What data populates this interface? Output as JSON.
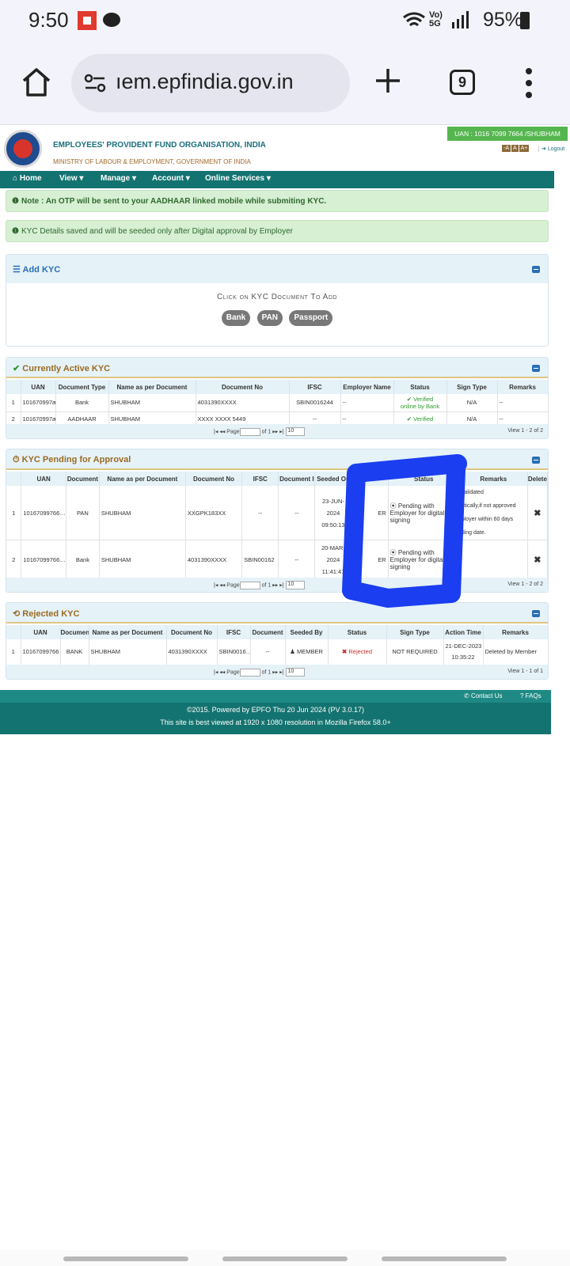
{
  "status_bar": {
    "time": "9:50",
    "signal_label": "Vo) 5G",
    "battery": "95%"
  },
  "browser": {
    "url": "ıem.epfindia.gov.in",
    "tab_count": "9"
  },
  "header": {
    "org_name": "EMPLOYEES' PROVIDENT FUND ORGANISATION, INDIA",
    "ministry": "MINISTRY OF LABOUR & EMPLOYMENT, GOVERNMENT OF INDIA",
    "uan_badge": "UAN : 1016 7099 7664 /SHUBHAM",
    "font_sizes": [
      "-A",
      "A",
      "A+"
    ],
    "logout": "Logout"
  },
  "nav": {
    "home": "Home",
    "view": "View ▾",
    "manage": "Manage ▾",
    "account": "Account ▾",
    "online_services": "Online Services ▾"
  },
  "alerts": {
    "otp_note": "Note : An OTP will be sent to your AADHAAR linked mobile while submiting KYC.",
    "saved_note": "KYC Details saved and will be seeded only after Digital approval by Employer"
  },
  "add_kyc": {
    "title": "Add KYC",
    "instruction": "Click on KYC Document To Add",
    "buttons": [
      "Bank",
      "PAN",
      "Passport"
    ]
  },
  "active_kyc": {
    "title": "Currently Active KYC",
    "columns": [
      "UAN",
      "Document Type",
      "Name as per Document",
      "Document No",
      "IFSC",
      "Employer Name",
      "Status",
      "Sign Type",
      "Remarks"
    ],
    "rows": [
      {
        "n": "1",
        "uan": "101670997æ",
        "doc_type": "Bank",
        "name": "SHUBHAM",
        "doc_no": "4031390XXXX",
        "ifsc": "SBIN0016244",
        "employer": "--",
        "status1": "✔ Verified",
        "status2": "online by Bank",
        "sign": "N/A",
        "remarks": "--"
      },
      {
        "n": "2",
        "uan": "101670997æ",
        "doc_type": "AADHAAR",
        "name": "SHUBHAM",
        "doc_no": "XXXX XXXX 5449",
        "ifsc": "--",
        "employer": "--",
        "status1": "✔ Verified",
        "status2": "",
        "sign": "N/A",
        "remarks": "--"
      }
    ],
    "pager": {
      "page": "Page",
      "of": "of 1",
      "per_page": "10",
      "view": "View 1 - 2 of 2"
    }
  },
  "pending_kyc": {
    "title": "KYC Pending for Approval",
    "columns": [
      "UAN",
      "Document",
      "Name as per Document",
      "Document No",
      "IFSC",
      "Document I",
      "Seeded On",
      "",
      "Status",
      "Remarks",
      "Delete"
    ],
    "rows": [
      {
        "n": "1",
        "uan": "10167099766…",
        "doc": "PAN",
        "name": "SHUBHAM",
        "doc_no": "XXGPK183XX",
        "ifsc": "--",
        "doc_i": "--",
        "seeded1": "23-JUN-",
        "seeded2": "2024",
        "seeded3": "09:50:13",
        "by": "ER",
        "status": "⦿ Pending with Employer for digital signing",
        "remarks1": "validated",
        "remarks2": "stically,if not approved",
        "remarks3": "ployer within 60 days",
        "remarks4": "ding date."
      },
      {
        "n": "2",
        "uan": "10167099766…",
        "doc": "Bank",
        "name": "SHUBHAM",
        "doc_no": "4031390XXXX",
        "ifsc": "SBIN00162",
        "doc_i": "--",
        "seeded1": "20-MAR-",
        "seeded2": "2024",
        "seeded3": "11:41:47",
        "by": "ER",
        "status": "⦿ Pending with Employer for digital signing",
        "remarks1": "",
        "remarks2": "",
        "remarks3": "",
        "remarks4": ""
      }
    ],
    "pager": {
      "page": "Page",
      "of": "of 1",
      "per_page": "10",
      "view": "View 1 - 2 of 2"
    }
  },
  "rejected_kyc": {
    "title": "Rejected KYC",
    "columns": [
      "UAN",
      "Documen",
      "Name as per Document",
      "Document No",
      "IFSC",
      "Document",
      "Seeded By",
      "Status",
      "Sign Type",
      "Action Time",
      "Remarks"
    ],
    "rows": [
      {
        "n": "1",
        "uan": "10167099766",
        "doc": "BANK",
        "name": "SHUBHAM",
        "doc_no": "4031390XXXX",
        "ifsc": "SBIN0016…",
        "document": "--",
        "seeded_by": "MEMBER",
        "status": "Rejected",
        "sign": "NOT REQUIRED",
        "time1": "21-DEC-2023",
        "time2": "10:35:22",
        "remarks": "Deleted by Member"
      }
    ],
    "pager": {
      "page": "Page",
      "of": "of 1",
      "per_page": "10",
      "view": "View 1 - 1 of 1"
    }
  },
  "footer": {
    "contact": "Contact Us",
    "faqs": "FAQs",
    "line1": "©2015. Powered by EPFO Thu 20 Jun 2024 (PV 3.0.17)",
    "line2": "This site is best viewed at 1920 x 1080 resolution in Mozilla Firefox 58.0+"
  },
  "colors": {
    "teal": "#137370",
    "annotation_blue": "#1a3ef0",
    "verified_green": "#2f9a2f",
    "rejected_red": "#c93030"
  }
}
